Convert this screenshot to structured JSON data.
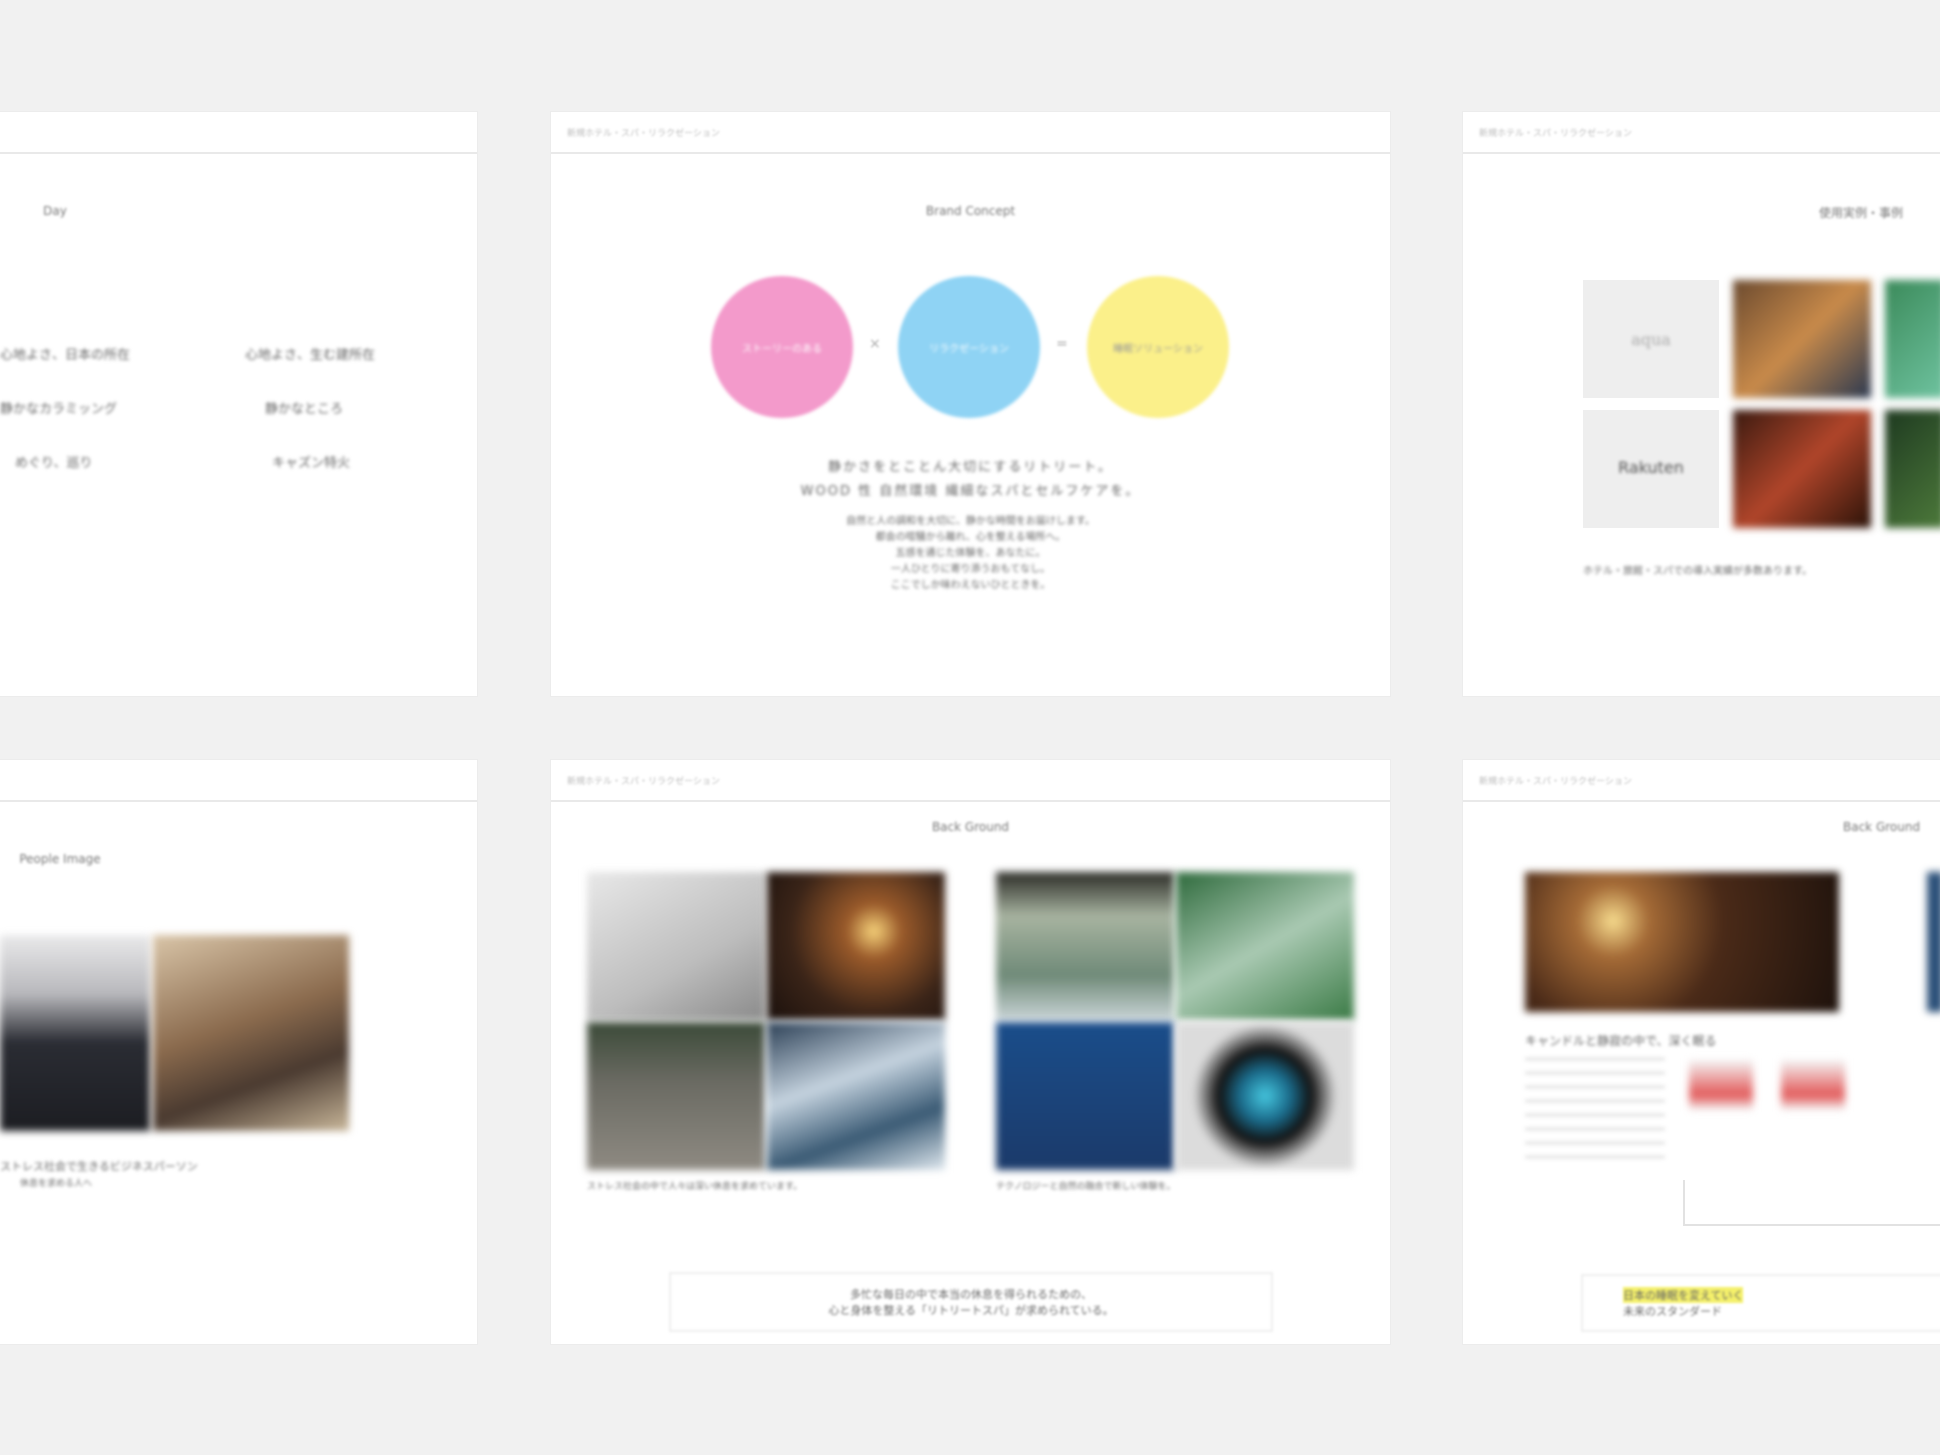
{
  "page": {
    "bg": "#f1f1f1"
  },
  "slides": {
    "tl": {
      "title": "Day",
      "items": [
        "心地よさ、日本の所在",
        "心地よさ、生む建所在",
        "静かなカラミッング",
        "静かなところ",
        "めぐり、巡り",
        "キャズン特火"
      ]
    },
    "tm": {
      "crumb": "新規ホテル・スパ・リラクゼーション",
      "title": "Brand Concept",
      "circles": [
        {
          "label": "ストーリーのある",
          "color": "#f39acb"
        },
        {
          "label": "リラクゼーション",
          "color": "#8fd3f4"
        },
        {
          "label": "睡眠ソリューション",
          "color": "#fbf08a"
        }
      ],
      "sep1": "×",
      "sep2": "=",
      "headline1": "静かさをとことん大切にするリトリート。",
      "headline2": "WOOD 性 自然環境 繊細なスパとセルフケアを。",
      "para": [
        "自然と人の調和を大切に、静かな時間をお届けします。",
        "都会の喧騒から離れ、心を整える場所へ。",
        "五感を通じた体験を、あなたに。",
        "一人ひとりに寄り添うおもてなし。",
        "ここでしか味わえないひとときを。"
      ]
    },
    "tr": {
      "crumb": "新規ホテル・スパ・リラクゼーション",
      "title": "使用実例・事例",
      "logo1": "aqua",
      "logo2": "Rakuten",
      "caption": "ホテル・旅館・スパでの導入実績が多数あります。"
    },
    "bl": {
      "title": "People Image",
      "caption1": "ストレス社会で生きるビジネスパーソン",
      "caption2": "休息を求める人へ"
    },
    "bm": {
      "crumb": "新規ホテル・スパ・リラクゼーション",
      "title": "Back Ground",
      "text_left": "ストレス社会の中で人々は深い休息を求めています。",
      "text_right": "テクノロジーと自然の融合で新しい体験を。",
      "note1": "多忙な毎日の中で本当の休息を得られるための、",
      "note2": "心と身体を整える「リトリートスパ」が求められている。"
    },
    "br": {
      "crumb": "新規ホテル・スパ・リラクゼーション",
      "title": "Back Ground",
      "heading": "キャンドルと静寂の中で、深く眠る",
      "note1": "日本の睡眠を変えていく",
      "note2": "未来のスタンダード"
    }
  }
}
